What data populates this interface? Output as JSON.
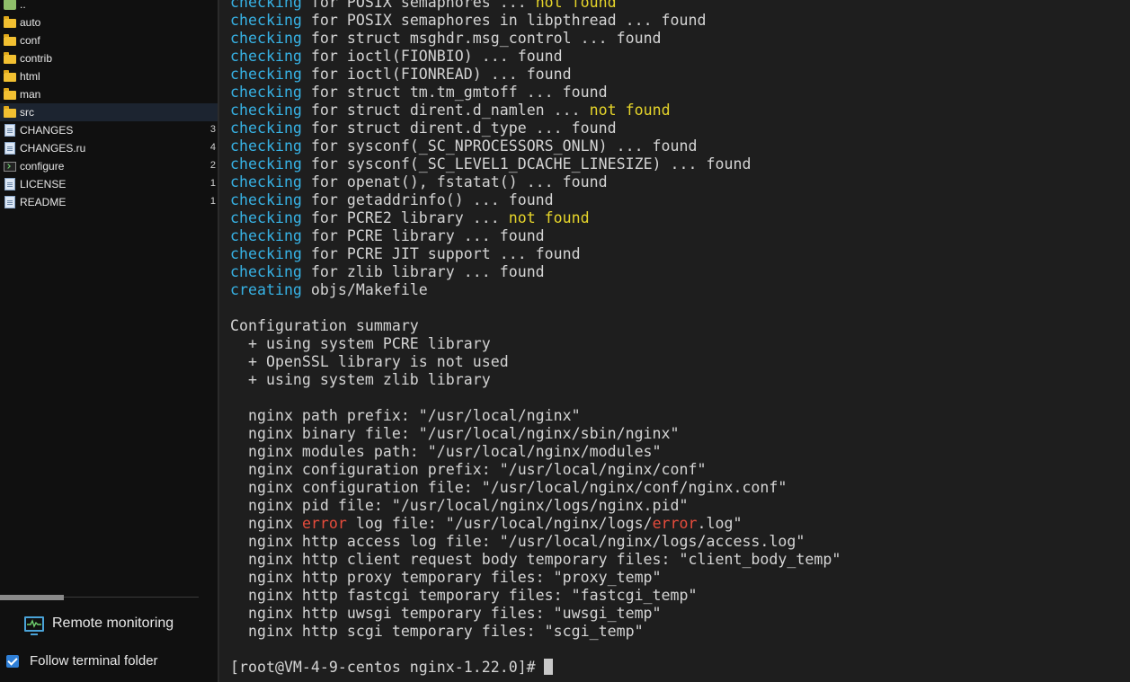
{
  "file_panel": {
    "items": [
      {
        "name": "..",
        "type": "parent",
        "size": ""
      },
      {
        "name": "auto",
        "type": "folder",
        "size": ""
      },
      {
        "name": "conf",
        "type": "folder",
        "size": ""
      },
      {
        "name": "contrib",
        "type": "folder",
        "size": ""
      },
      {
        "name": "html",
        "type": "folder",
        "size": ""
      },
      {
        "name": "man",
        "type": "folder",
        "size": ""
      },
      {
        "name": "src",
        "type": "folder",
        "size": "",
        "selected": true
      },
      {
        "name": "CHANGES",
        "type": "document",
        "size": "3"
      },
      {
        "name": "CHANGES.ru",
        "type": "document",
        "size": "4"
      },
      {
        "name": "configure",
        "type": "terminal",
        "size": "2"
      },
      {
        "name": "LICENSE",
        "type": "document",
        "size": "1"
      },
      {
        "name": "README",
        "type": "document",
        "size": "1"
      }
    ],
    "remote_monitoring_label": "Remote monitoring",
    "follow_terminal_label": "Follow terminal folder",
    "follow_terminal_checked": true
  },
  "terminal": {
    "colors": {
      "keyword": "#37b3e6",
      "warning": "#e5d42a",
      "error": "#e74c3c",
      "text": "#d4d4d4"
    },
    "lines": [
      [
        {
          "t": "checking",
          "c": "cyan"
        },
        {
          "t": " for POSIX semaphores ... "
        },
        {
          "t": "not found",
          "c": "yellow"
        }
      ],
      [
        {
          "t": "checking",
          "c": "cyan"
        },
        {
          "t": " for POSIX semaphores in libpthread ... found"
        }
      ],
      [
        {
          "t": "checking",
          "c": "cyan"
        },
        {
          "t": " for struct msghdr.msg_control ... found"
        }
      ],
      [
        {
          "t": "checking",
          "c": "cyan"
        },
        {
          "t": " for ioctl(FIONBIO) ... found"
        }
      ],
      [
        {
          "t": "checking",
          "c": "cyan"
        },
        {
          "t": " for ioctl(FIONREAD) ... found"
        }
      ],
      [
        {
          "t": "checking",
          "c": "cyan"
        },
        {
          "t": " for struct tm.tm_gmtoff ... found"
        }
      ],
      [
        {
          "t": "checking",
          "c": "cyan"
        },
        {
          "t": " for struct dirent.d_namlen ... "
        },
        {
          "t": "not found",
          "c": "yellow"
        }
      ],
      [
        {
          "t": "checking",
          "c": "cyan"
        },
        {
          "t": " for struct dirent.d_type ... found"
        }
      ],
      [
        {
          "t": "checking",
          "c": "cyan"
        },
        {
          "t": " for sysconf(_SC_NPROCESSORS_ONLN) ... found"
        }
      ],
      [
        {
          "t": "checking",
          "c": "cyan"
        },
        {
          "t": " for sysconf(_SC_LEVEL1_DCACHE_LINESIZE) ... found"
        }
      ],
      [
        {
          "t": "checking",
          "c": "cyan"
        },
        {
          "t": " for openat(), fstatat() ... found"
        }
      ],
      [
        {
          "t": "checking",
          "c": "cyan"
        },
        {
          "t": " for getaddrinfo() ... found"
        }
      ],
      [
        {
          "t": "checking",
          "c": "cyan"
        },
        {
          "t": " for PCRE2 library ... "
        },
        {
          "t": "not found",
          "c": "yellow"
        }
      ],
      [
        {
          "t": "checking",
          "c": "cyan"
        },
        {
          "t": " for PCRE library ... found"
        }
      ],
      [
        {
          "t": "checking",
          "c": "cyan"
        },
        {
          "t": " for PCRE JIT support ... found"
        }
      ],
      [
        {
          "t": "checking",
          "c": "cyan"
        },
        {
          "t": " for zlib library ... found"
        }
      ],
      [
        {
          "t": "creating",
          "c": "cyan"
        },
        {
          "t": " objs/Makefile"
        }
      ],
      [],
      [
        {
          "t": "Configuration summary"
        }
      ],
      [
        {
          "t": "  + using system PCRE library"
        }
      ],
      [
        {
          "t": "  + OpenSSL library is not used"
        }
      ],
      [
        {
          "t": "  + using system zlib library"
        }
      ],
      [],
      [
        {
          "t": "  nginx path prefix: \"/usr/local/nginx\""
        }
      ],
      [
        {
          "t": "  nginx binary file: \"/usr/local/nginx/sbin/nginx\""
        }
      ],
      [
        {
          "t": "  nginx modules path: \"/usr/local/nginx/modules\""
        }
      ],
      [
        {
          "t": "  nginx configuration prefix: \"/usr/local/nginx/conf\""
        }
      ],
      [
        {
          "t": "  nginx configuration file: \"/usr/local/nginx/conf/nginx.conf\""
        }
      ],
      [
        {
          "t": "  nginx pid file: \"/usr/local/nginx/logs/nginx.pid\""
        }
      ],
      [
        {
          "t": "  nginx "
        },
        {
          "t": "error",
          "c": "red"
        },
        {
          "t": " log file: \"/usr/local/nginx/logs/"
        },
        {
          "t": "error",
          "c": "red"
        },
        {
          "t": ".log\""
        }
      ],
      [
        {
          "t": "  nginx http access log file: \"/usr/local/nginx/logs/access.log\""
        }
      ],
      [
        {
          "t": "  nginx http client request body temporary files: \"client_body_temp\""
        }
      ],
      [
        {
          "t": "  nginx http proxy temporary files: \"proxy_temp\""
        }
      ],
      [
        {
          "t": "  nginx http fastcgi temporary files: \"fastcgi_temp\""
        }
      ],
      [
        {
          "t": "  nginx http uwsgi temporary files: \"uwsgi_temp\""
        }
      ],
      [
        {
          "t": "  nginx http scgi temporary files: \"scgi_temp\""
        }
      ],
      [],
      [
        {
          "t": "[root@VM-4-9-centos nginx-1.22.0]#"
        },
        {
          "cursor": true
        }
      ]
    ]
  }
}
